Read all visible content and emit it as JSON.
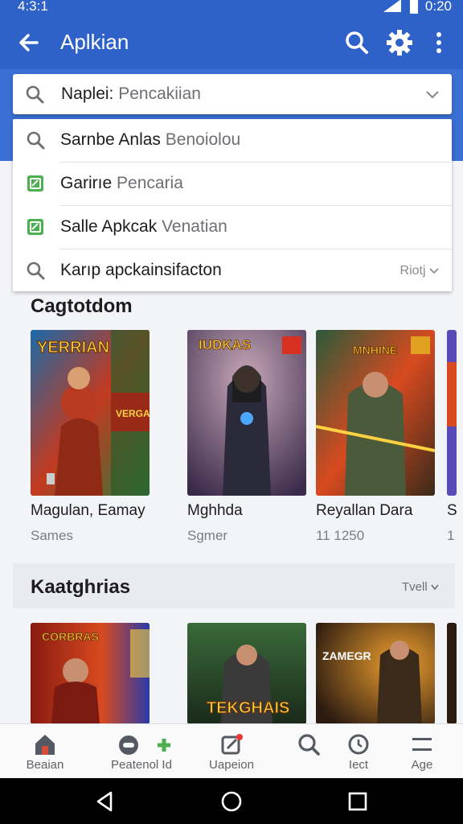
{
  "status": {
    "time_left": "4:3:1",
    "time_right": "0:20"
  },
  "appbar": {
    "title": "Aplkian"
  },
  "search": {
    "typed": "Naplei:",
    "placeholder": " Pencakiian"
  },
  "suggestions": [
    {
      "icon": "search-icon",
      "text": "Sarnbe Anlas",
      "muted": " Benoiolou",
      "tail": ""
    },
    {
      "icon": "app-green-icon",
      "text": "Garirıe",
      "muted": " Pencaria",
      "tail": ""
    },
    {
      "icon": "app-green-icon",
      "text": "Salle Apkcak",
      "muted": " Venatian",
      "tail": ""
    },
    {
      "icon": "search-icon",
      "text": "Karıp apckainsifacton",
      "muted": "",
      "tail": "Riotj"
    }
  ],
  "section1": {
    "title": "Cagtotdom",
    "games": [
      {
        "name": "Magulan, Eamay",
        "sub": "Sames",
        "art_text": "YERRIAN",
        "badge": "VERGAM"
      },
      {
        "name": "Mghhda",
        "sub": "Sgmer",
        "art_text": "IUDKAS",
        "badge": ""
      },
      {
        "name": "Reyallan Dara",
        "sub": "11 1250",
        "art_text": "MNHINE",
        "badge": ""
      },
      {
        "name": "S",
        "sub": "1",
        "art_text": "",
        "badge": ""
      }
    ]
  },
  "section2": {
    "title": "Kaatghrias",
    "more": "Tvell",
    "games": [
      {
        "art_text": "CORBRAS"
      },
      {
        "art_text": "TEKGHAIS"
      },
      {
        "art_text": "ZAMEGR"
      }
    ]
  },
  "bottom_nav": [
    {
      "icon": "home-icon",
      "label": "Beaian"
    },
    {
      "icon": "game-icon",
      "label": "Peatenol Id"
    },
    {
      "icon": "edit-icon",
      "label": "Uapeion"
    },
    {
      "icon": "search-icon",
      "label": ""
    },
    {
      "icon": "clock-icon",
      "label": "Iect"
    },
    {
      "icon": "menu-icon",
      "label": "Age"
    }
  ],
  "colors": {
    "primary": "#2f62c9",
    "accent": "#4caf50"
  }
}
